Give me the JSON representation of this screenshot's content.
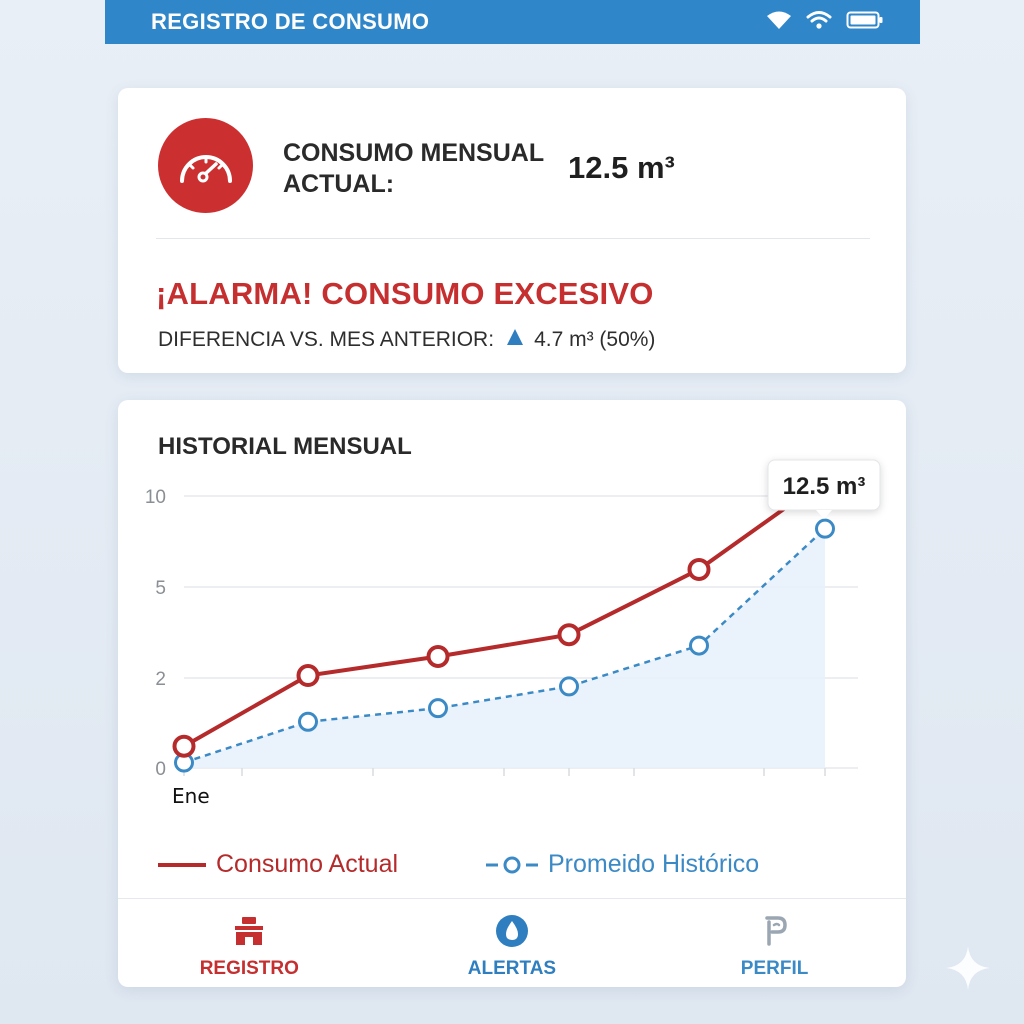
{
  "status_bar": {
    "title": "REGISTRO DE CONSUMO",
    "color": "#2f86c9",
    "icons": [
      "signal-icon",
      "wifi-icon",
      "battery-icon"
    ]
  },
  "summary": {
    "icon": "gauge-icon",
    "label": "CONSUMO MENSUAL ACTUAL:",
    "value": "12.5 m³",
    "alarm": "¡ALARMA! CONSUMO EXCESIVO",
    "diff_label": "DIFERENCIA VS. MES ANTERIOR:",
    "diff_icon": "up-triangle-icon",
    "diff_value": "4.7 m³ (50%)",
    "alarm_color": "#c62f2f"
  },
  "chart_data": {
    "type": "line",
    "title": "HISTORIAL MENSUAL",
    "y_ticks": [
      "10",
      "5",
      "2",
      "0"
    ],
    "x_labels": [
      "Ene"
    ],
    "series": [
      {
        "name": "Consumo Actual",
        "color": "#b52a2a",
        "style": "solid",
        "values": [
          0.8,
          3.4,
          4.1,
          4.9,
          7.3,
          10.6
        ]
      },
      {
        "name": "Promeido Histórico",
        "color": "#3b8ac6",
        "style": "dashed",
        "values": [
          0.2,
          1.7,
          2.2,
          3.0,
          4.5,
          8.8
        ]
      }
    ],
    "ylim": [
      0,
      10
    ],
    "grid": true,
    "tooltip": "12.5 m³"
  },
  "nav": {
    "items": [
      {
        "label": "REGISTRO",
        "icon": "building-icon",
        "color": "#c62f2f"
      },
      {
        "label": "ALERTAS",
        "icon": "alert-drop-icon",
        "color": "#2f7fc0"
      },
      {
        "label": "PERFIL",
        "icon": "profile-icon",
        "color": "#3b8ac6"
      }
    ]
  }
}
